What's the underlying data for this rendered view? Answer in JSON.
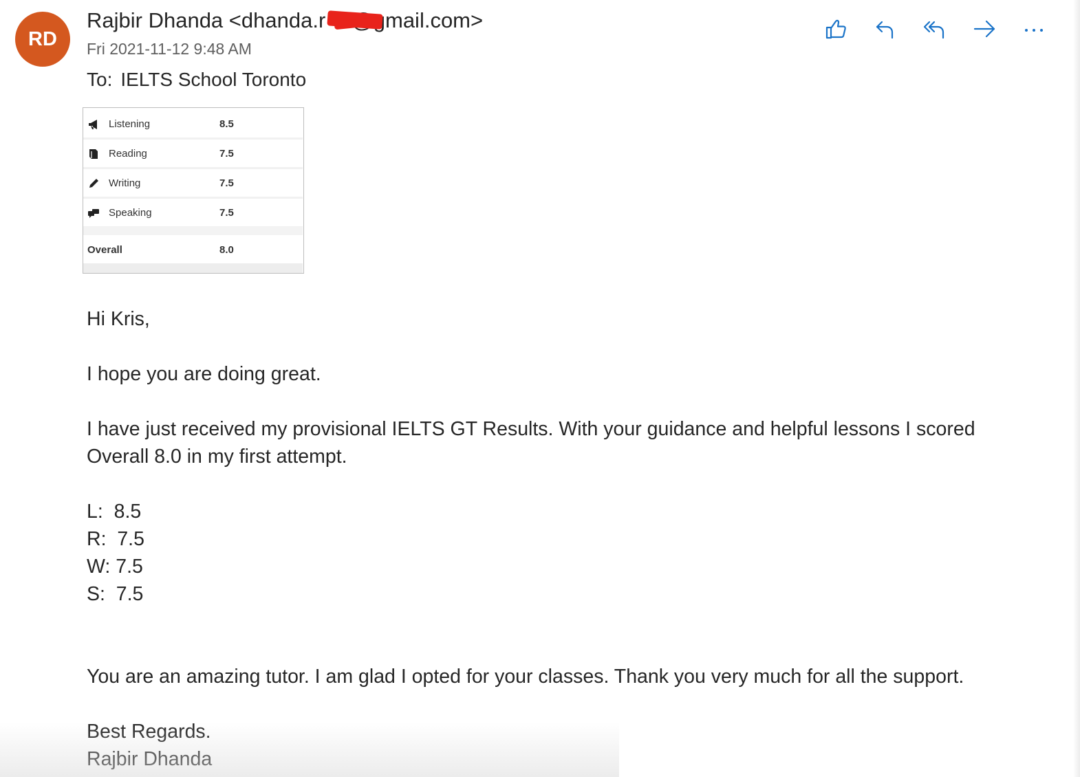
{
  "message": {
    "avatar_initials": "RD",
    "sender_display": "Rajbir Dhanda <dhanda.r",
    "sender_email_suffix": "@gmail.com>",
    "date": "Fri 2021-11-12 9:48 AM",
    "to_label": "To:",
    "to_recipient": "IELTS School Toronto"
  },
  "toolbar": {
    "like": "thumbs-up-icon",
    "reply": "reply-icon",
    "reply_all": "reply-all-icon",
    "forward": "forward-icon",
    "more": "more-icon"
  },
  "score_card": {
    "rows": [
      {
        "label": "Listening",
        "value": "8.5",
        "icon": "megaphone-icon"
      },
      {
        "label": "Reading",
        "value": "7.5",
        "icon": "book-icon"
      },
      {
        "label": "Writing",
        "value": "7.5",
        "icon": "pencil-icon"
      },
      {
        "label": "Speaking",
        "value": "7.5",
        "icon": "speech-bubbles-icon"
      }
    ],
    "overall_label": "Overall",
    "overall_value": "8.0"
  },
  "body": {
    "greeting": "Hi Kris,",
    "line1": "I hope you are doing great.",
    "para1": "I have just received my provisional IELTS GT Results. With your guidance and helpful lessons I scored Overall 8.0 in my first attempt.",
    "scores": [
      "L:  8.5",
      "R:  7.5",
      "W: 7.5",
      "S:  7.5"
    ],
    "para2": "You are an amazing tutor. I am glad I opted for your classes. Thank you very much for all the support.",
    "closing": "Best Regards.",
    "signature": "Rajbir Dhanda"
  },
  "colors": {
    "avatar_bg": "#d4581f",
    "toolbar_icon": "#1a73c8",
    "redaction": "#e8231b"
  }
}
